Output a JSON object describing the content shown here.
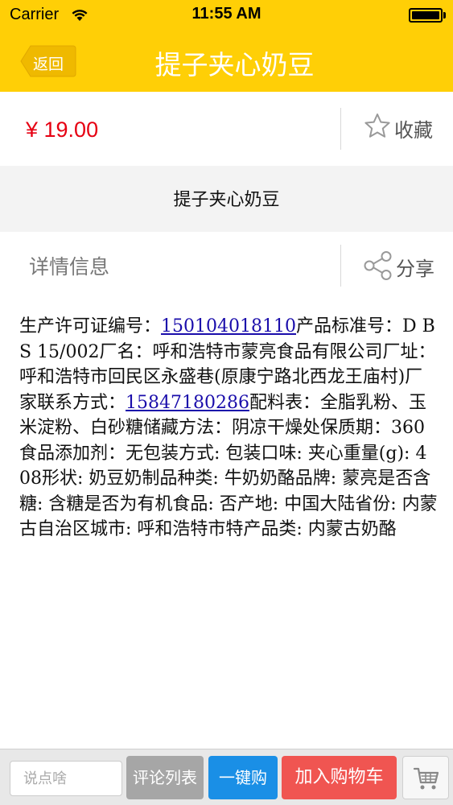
{
  "status_bar": {
    "carrier": "Carrier",
    "time": "11:55 AM"
  },
  "nav": {
    "back_label": "返回",
    "title": "提子夹心奶豆"
  },
  "product": {
    "price": "¥ 19.00",
    "favorite_label": "收藏",
    "name": "提子夹心奶豆"
  },
  "details": {
    "label": "详情信息",
    "share_label": "分享",
    "text_1": "生产许可证编号：",
    "license_link": "150104018110",
    "text_2": "产品标准号：D B S 15/002厂名：呼和浩特市蒙亮食品有限公司厂址：呼和浩特市回民区永盛巷(原康宁路北西龙王庙村)厂家联系方式：",
    "phone_link": "15847180286",
    "text_3": "配料表：全脂乳粉、玉米淀粉、白砂糖储藏方法：阴凉干燥处保质期：360食品添加剂：无包装方式: 包装口味: 夹心重量(g): 408形状: 奶豆奶制品种类: 牛奶奶酪品牌: 蒙亮是否含糖: 含糖是否为有机食品: 否产地: 中国大陆省份: 内蒙古自治区城市: 呼和浩特市特产品类: 内蒙古奶酪"
  },
  "bottom_bar": {
    "comment_placeholder": "说点啥",
    "comments_label": "评论列表",
    "buy_now_label": "一键购",
    "add_to_cart_label": "加入购物车"
  },
  "colors": {
    "brand_yellow": "#ffcf06",
    "price_red": "#e60012",
    "buy_blue": "#1a8fe6",
    "cart_red": "#f05551",
    "comments_gray": "#a6a6a6"
  },
  "icons": {
    "wifi": "wifi-icon",
    "battery": "battery-icon",
    "favorite": "star-icon",
    "share": "share-icon",
    "cart": "cart-icon"
  }
}
